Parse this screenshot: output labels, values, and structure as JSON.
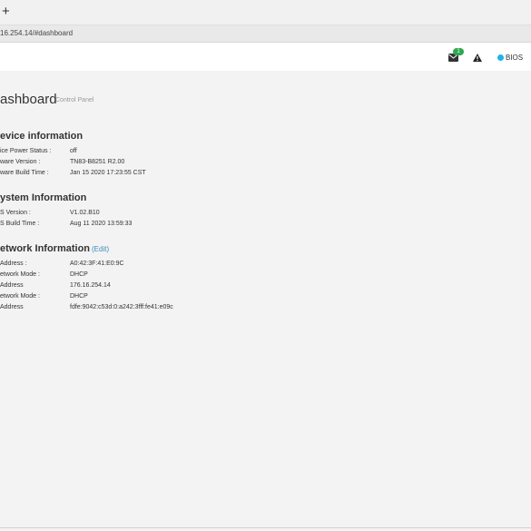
{
  "browser": {
    "new_tab_symbol": "+",
    "url": "16.254.14/#dashboard"
  },
  "header": {
    "notification_count": "1",
    "icons": [
      "envelope-icon",
      "warning-icon"
    ],
    "bios_label": "BIOS",
    "bios_dot_color": "#1fb3e6",
    "badge_color": "#2fa84f"
  },
  "page": {
    "title": "ashboard",
    "subtitle": "Control Panel"
  },
  "device_info": {
    "title": "evice information",
    "rows": [
      {
        "label": "ice Power Status :",
        "value": "off"
      },
      {
        "label": "ware Version :",
        "value": "TN83-B8251 R2.00"
      },
      {
        "label": "ware Build Time :",
        "value": "Jan 15 2020 17:23:55 CST"
      }
    ]
  },
  "system_info": {
    "title": "ystem Information",
    "rows": [
      {
        "label": "S Version :",
        "value": "V1.02.B10"
      },
      {
        "label": "S Build Time :",
        "value": "Aug 11 2020 13:59:33"
      }
    ]
  },
  "network_info": {
    "title": "etwork Information",
    "edit_label": "(Edit)",
    "rows": [
      {
        "label": "Address :",
        "value": "A0:42:3F:41:E0:9C"
      },
      {
        "label": "etwork Mode :",
        "value": "DHCP"
      },
      {
        "label": "Address",
        "value": "176.16.254.14"
      },
      {
        "label": "etwork Mode :",
        "value": "DHCP"
      },
      {
        "label": "Address",
        "value": "fdfe:9042:c53d:0:a242:3fff:fe41:e09c"
      }
    ]
  }
}
